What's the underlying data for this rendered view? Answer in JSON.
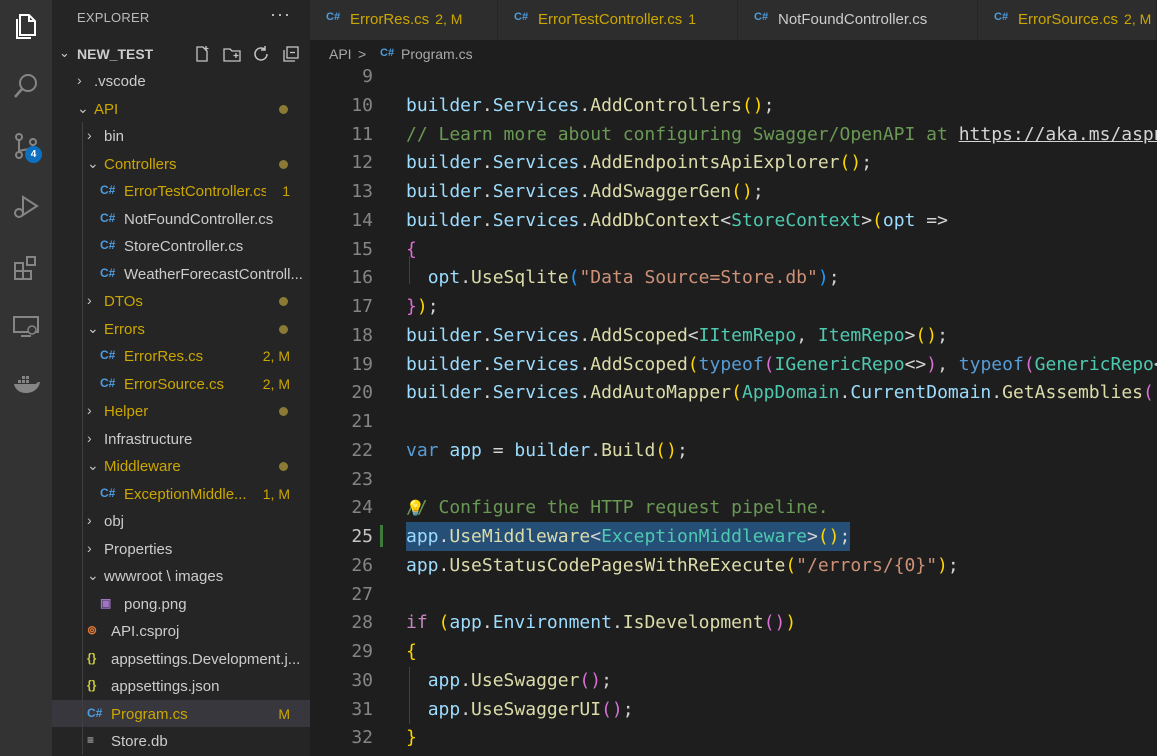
{
  "activity_bar": {
    "items": [
      {
        "name": "explorer-icon",
        "active": true
      },
      {
        "name": "search-icon"
      },
      {
        "name": "source-control-icon",
        "badge": "4"
      },
      {
        "name": "run-debug-icon"
      },
      {
        "name": "extensions-icon"
      },
      {
        "name": "remote-explorer-icon"
      },
      {
        "name": "docker-icon"
      }
    ]
  },
  "sidebar": {
    "title": "EXPLORER",
    "more": "···",
    "project": "NEW_TEST",
    "tree": [
      {
        "label": ".vscode",
        "type": "folder",
        "chev": "›",
        "color": "#cccccc"
      },
      {
        "label": "API",
        "type": "folder",
        "chev": "⌄",
        "color": "#cca700",
        "dot": true
      },
      {
        "label": "bin",
        "type": "folder",
        "chev": "›",
        "color": "#cccccc"
      },
      {
        "label": "Controllers",
        "type": "folder",
        "chev": "⌄",
        "color": "#cca700",
        "dot": true
      },
      {
        "label": "ErrorTestController.cs",
        "type": "cs",
        "color": "#cca700",
        "status": "1"
      },
      {
        "label": "NotFoundController.cs",
        "type": "cs",
        "color": "#cccccc"
      },
      {
        "label": "StoreController.cs",
        "type": "cs",
        "color": "#cccccc"
      },
      {
        "label": "WeatherForecastControll...",
        "type": "cs",
        "color": "#cccccc"
      },
      {
        "label": "DTOs",
        "type": "folder",
        "chev": "›",
        "color": "#cca700",
        "dot": true
      },
      {
        "label": "Errors",
        "type": "folder",
        "chev": "⌄",
        "color": "#cca700",
        "dot": true
      },
      {
        "label": "ErrorRes.cs",
        "type": "cs",
        "color": "#cca700",
        "status": "2, M"
      },
      {
        "label": "ErrorSource.cs",
        "type": "cs",
        "color": "#cca700",
        "status": "2, M"
      },
      {
        "label": "Helper",
        "type": "folder",
        "chev": "›",
        "color": "#cca700",
        "dot": true
      },
      {
        "label": "Infrastructure",
        "type": "folder",
        "chev": "›",
        "color": "#cccccc"
      },
      {
        "label": "Middleware",
        "type": "folder",
        "chev": "⌄",
        "color": "#cca700",
        "dot": true
      },
      {
        "label": "ExceptionMiddle...",
        "type": "cs",
        "color": "#cca700",
        "status": "1, M"
      },
      {
        "label": "obj",
        "type": "folder",
        "chev": "›",
        "color": "#cccccc"
      },
      {
        "label": "Properties",
        "type": "folder",
        "chev": "›",
        "color": "#cccccc"
      },
      {
        "label": "wwwroot \\ images",
        "type": "folder",
        "chev": "⌄",
        "color": "#cccccc"
      },
      {
        "label": "pong.png",
        "type": "img",
        "color": "#cccccc"
      },
      {
        "label": "API.csproj",
        "type": "rss",
        "color": "#cccccc"
      },
      {
        "label": "appsettings.Development.j...",
        "type": "json",
        "color": "#cccccc"
      },
      {
        "label": "appsettings.json",
        "type": "json",
        "color": "#cccccc"
      },
      {
        "label": "Program.cs",
        "type": "cs",
        "color": "#cca700",
        "status": "M",
        "selected": true
      },
      {
        "label": "Store.db",
        "type": "db",
        "color": "#cccccc"
      }
    ]
  },
  "tabs": [
    {
      "label": "ErrorRes.cs",
      "status": "2, M",
      "color": "#cca700"
    },
    {
      "label": "ErrorTestController.cs",
      "status": "1",
      "color": "#cca700"
    },
    {
      "label": "NotFoundController.cs",
      "status": "",
      "color": "#cccccc"
    },
    {
      "label": "ErrorSource.cs",
      "status": "2, M",
      "color": "#cca700"
    }
  ],
  "breadcrumb": {
    "folder": "API",
    "separator": ">",
    "file": "Program.cs"
  },
  "editor": {
    "active_line": 25,
    "lines": [
      {
        "n": 9,
        "tokens": []
      },
      {
        "n": 10,
        "tokens": [
          [
            "var",
            "builder"
          ],
          [
            "pl",
            "."
          ],
          [
            "var",
            "Services"
          ],
          [
            "pl",
            "."
          ],
          [
            "fn",
            "AddControllers"
          ],
          [
            "p1",
            "()"
          ],
          [
            "pl",
            ";"
          ]
        ]
      },
      {
        "n": 11,
        "tokens": [
          [
            "cmt",
            "// Learn more about configuring Swagger/OpenAPI at "
          ],
          [
            "lnk",
            "https://aka.ms/aspnetcore/swashbuckle"
          ]
        ]
      },
      {
        "n": 12,
        "tokens": [
          [
            "var",
            "builder"
          ],
          [
            "pl",
            "."
          ],
          [
            "var",
            "Services"
          ],
          [
            "pl",
            "."
          ],
          [
            "fn",
            "AddEndpointsApiExplorer"
          ],
          [
            "p1",
            "()"
          ],
          [
            "pl",
            ";"
          ]
        ]
      },
      {
        "n": 13,
        "tokens": [
          [
            "var",
            "builder"
          ],
          [
            "pl",
            "."
          ],
          [
            "var",
            "Services"
          ],
          [
            "pl",
            "."
          ],
          [
            "fn",
            "AddSwaggerGen"
          ],
          [
            "p1",
            "()"
          ],
          [
            "pl",
            ";"
          ]
        ]
      },
      {
        "n": 14,
        "tokens": [
          [
            "var",
            "builder"
          ],
          [
            "pl",
            "."
          ],
          [
            "var",
            "Services"
          ],
          [
            "pl",
            "."
          ],
          [
            "fn",
            "AddDbContext"
          ],
          [
            "pl",
            "<"
          ],
          [
            "typ",
            "StoreContext"
          ],
          [
            "pl",
            ">"
          ],
          [
            "p1",
            "("
          ],
          [
            "var",
            "opt"
          ],
          [
            "pl",
            " =>"
          ]
        ]
      },
      {
        "n": 15,
        "tokens": [
          [
            "p2",
            "{"
          ]
        ]
      },
      {
        "n": 16,
        "tokens": [
          [
            "pl",
            "  "
          ],
          [
            "var",
            "opt"
          ],
          [
            "pl",
            "."
          ],
          [
            "fn",
            "UseSqlite"
          ],
          [
            "p3",
            "("
          ],
          [
            "str",
            "\"Data Source=Store.db\""
          ],
          [
            "p3",
            ")"
          ],
          [
            "pl",
            ";"
          ]
        ]
      },
      {
        "n": 17,
        "tokens": [
          [
            "p2",
            "}"
          ],
          [
            "p1",
            ")"
          ],
          [
            "pl",
            ";"
          ]
        ]
      },
      {
        "n": 18,
        "tokens": [
          [
            "var",
            "builder"
          ],
          [
            "pl",
            "."
          ],
          [
            "var",
            "Services"
          ],
          [
            "pl",
            "."
          ],
          [
            "fn",
            "AddScoped"
          ],
          [
            "pl",
            "<"
          ],
          [
            "typ",
            "IItemRepo"
          ],
          [
            "pl",
            ", "
          ],
          [
            "typ",
            "ItemRepo"
          ],
          [
            "pl",
            ">"
          ],
          [
            "p1",
            "()"
          ],
          [
            "pl",
            ";"
          ]
        ]
      },
      {
        "n": 19,
        "tokens": [
          [
            "var",
            "builder"
          ],
          [
            "pl",
            "."
          ],
          [
            "var",
            "Services"
          ],
          [
            "pl",
            "."
          ],
          [
            "fn",
            "AddScoped"
          ],
          [
            "p1",
            "("
          ],
          [
            "kw",
            "typeof"
          ],
          [
            "p2",
            "("
          ],
          [
            "typ",
            "IGenericRepo"
          ],
          [
            "pl",
            "<>"
          ],
          [
            "p2",
            ")"
          ],
          [
            "pl",
            ", "
          ],
          [
            "kw",
            "typeof"
          ],
          [
            "p2",
            "("
          ],
          [
            "typ",
            "GenericRepo"
          ],
          [
            "pl",
            "<>"
          ],
          [
            "p2",
            ")"
          ],
          [
            "p1",
            ")"
          ],
          [
            "pl",
            ";"
          ]
        ]
      },
      {
        "n": 20,
        "tokens": [
          [
            "var",
            "builder"
          ],
          [
            "pl",
            "."
          ],
          [
            "var",
            "Services"
          ],
          [
            "pl",
            "."
          ],
          [
            "fn",
            "AddAutoMapper"
          ],
          [
            "p1",
            "("
          ],
          [
            "typ",
            "AppDomain"
          ],
          [
            "pl",
            "."
          ],
          [
            "var",
            "CurrentDomain"
          ],
          [
            "pl",
            "."
          ],
          [
            "fn",
            "GetAssemblies"
          ],
          [
            "p2",
            "()"
          ],
          [
            "p1",
            ")"
          ],
          [
            "pl",
            ";"
          ]
        ]
      },
      {
        "n": 21,
        "tokens": []
      },
      {
        "n": 22,
        "tokens": [
          [
            "kw",
            "var"
          ],
          [
            "pl",
            " "
          ],
          [
            "var",
            "app"
          ],
          [
            "pl",
            " = "
          ],
          [
            "var",
            "builder"
          ],
          [
            "pl",
            "."
          ],
          [
            "fn",
            "Build"
          ],
          [
            "p1",
            "()"
          ],
          [
            "pl",
            ";"
          ]
        ]
      },
      {
        "n": 23,
        "tokens": []
      },
      {
        "n": 24,
        "tokens": [
          [
            "cmt",
            "// Configure the HTTP request pipeline."
          ]
        ],
        "bulb": true
      },
      {
        "n": 25,
        "tokens": [
          [
            "var",
            "app"
          ],
          [
            "pl",
            "."
          ],
          [
            "fn",
            "UseMiddleware"
          ],
          [
            "pl",
            "<"
          ],
          [
            "typ",
            "ExceptionMiddleware"
          ],
          [
            "pl",
            ">"
          ],
          [
            "p1",
            "()"
          ],
          [
            "pl",
            ";"
          ]
        ],
        "highlight": true
      },
      {
        "n": 26,
        "tokens": [
          [
            "var",
            "app"
          ],
          [
            "pl",
            "."
          ],
          [
            "fn",
            "UseStatusCodePagesWithReExecute"
          ],
          [
            "p1",
            "("
          ],
          [
            "str",
            "\"/errors/{0}\""
          ],
          [
            "p1",
            ")"
          ],
          [
            "pl",
            ";"
          ]
        ]
      },
      {
        "n": 27,
        "tokens": []
      },
      {
        "n": 28,
        "tokens": [
          [
            "kw2",
            "if"
          ],
          [
            "pl",
            " "
          ],
          [
            "p1",
            "("
          ],
          [
            "var",
            "app"
          ],
          [
            "pl",
            "."
          ],
          [
            "var",
            "Environment"
          ],
          [
            "pl",
            "."
          ],
          [
            "fn",
            "IsDevelopment"
          ],
          [
            "p2",
            "()"
          ],
          [
            "p1",
            ")"
          ]
        ]
      },
      {
        "n": 29,
        "tokens": [
          [
            "p1",
            "{"
          ]
        ]
      },
      {
        "n": 30,
        "tokens": [
          [
            "pl",
            "  "
          ],
          [
            "var",
            "app"
          ],
          [
            "pl",
            "."
          ],
          [
            "fn",
            "UseSwagger"
          ],
          [
            "p2",
            "()"
          ],
          [
            "pl",
            ";"
          ]
        ]
      },
      {
        "n": 31,
        "tokens": [
          [
            "pl",
            "  "
          ],
          [
            "var",
            "app"
          ],
          [
            "pl",
            "."
          ],
          [
            "fn",
            "UseSwaggerUI"
          ],
          [
            "p2",
            "()"
          ],
          [
            "pl",
            ";"
          ]
        ]
      },
      {
        "n": 32,
        "tokens": [
          [
            "p1",
            "}"
          ]
        ]
      }
    ]
  }
}
